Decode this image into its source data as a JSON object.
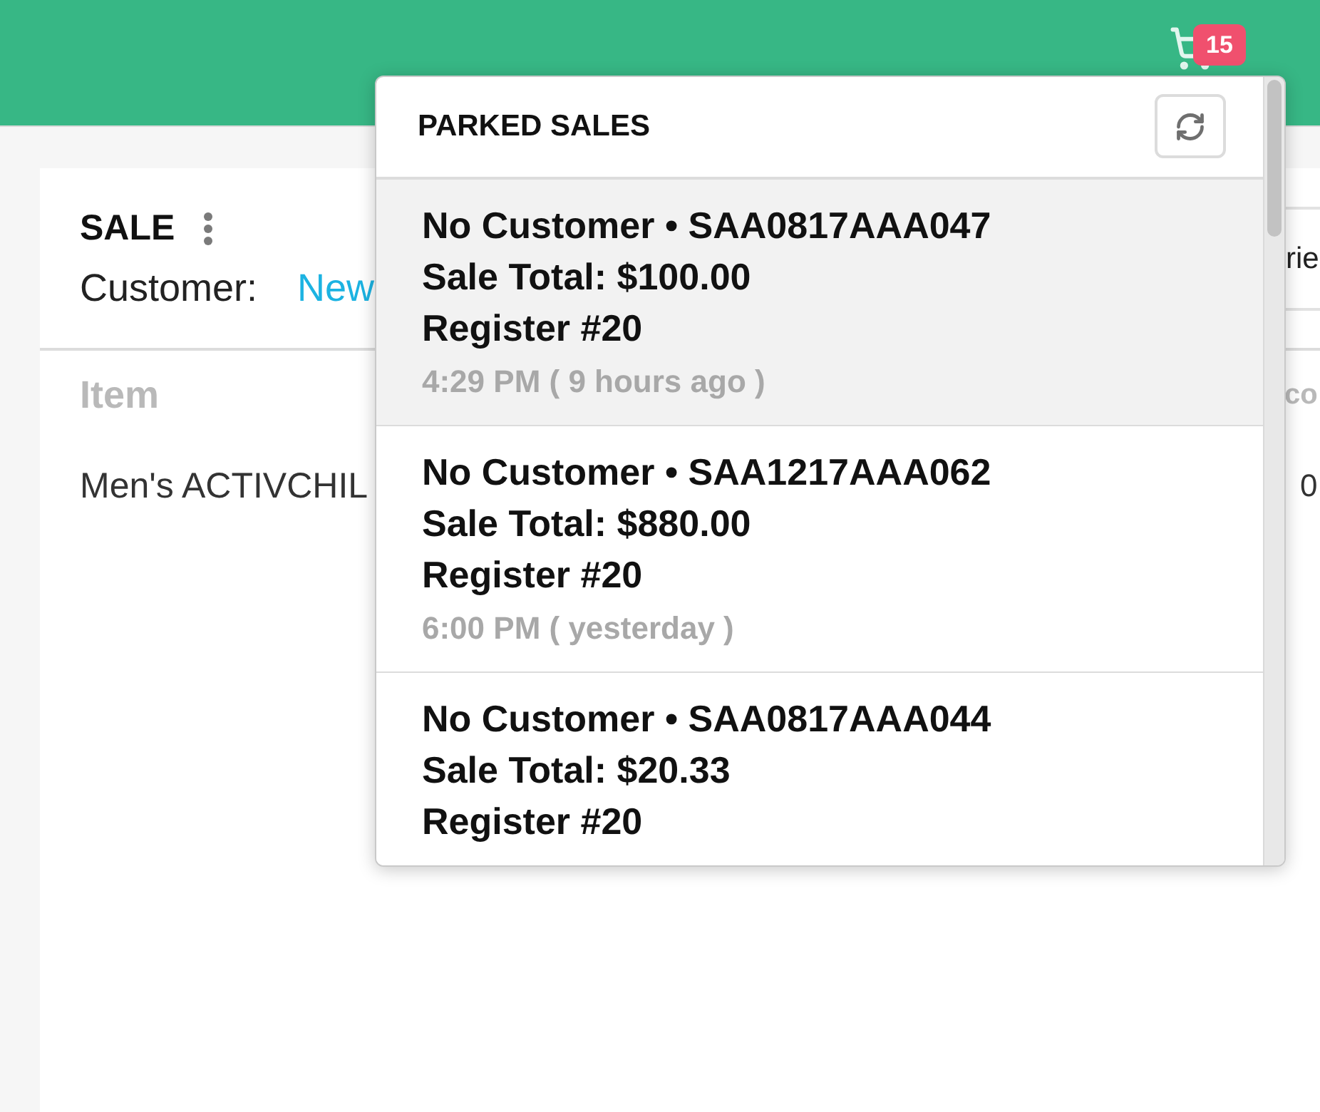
{
  "header": {
    "cart_badge": "15"
  },
  "sale": {
    "title": "SALE",
    "customer_label": "Customer:",
    "customer_value": "New",
    "side_box": "rie"
  },
  "table": {
    "columns": [
      "Item",
      "co"
    ],
    "rows": [
      [
        "Men's ACTIVCHIL",
        "0"
      ]
    ]
  },
  "parked_sales": {
    "title": "PARKED SALES",
    "items": [
      {
        "title": "No Customer • SAA0817AAA047",
        "total": "Sale Total: $100.00",
        "register": "Register #20",
        "time": "4:29 PM ( 9 hours ago )",
        "selected": true
      },
      {
        "title": "No Customer • SAA1217AAA062",
        "total": "Sale Total: $880.00",
        "register": "Register #20",
        "time": "6:00 PM ( yesterday )",
        "selected": false
      },
      {
        "title": "No Customer • SAA0817AAA044",
        "total": "Sale Total: $20.33",
        "register": "Register #20",
        "selected": false
      }
    ]
  }
}
